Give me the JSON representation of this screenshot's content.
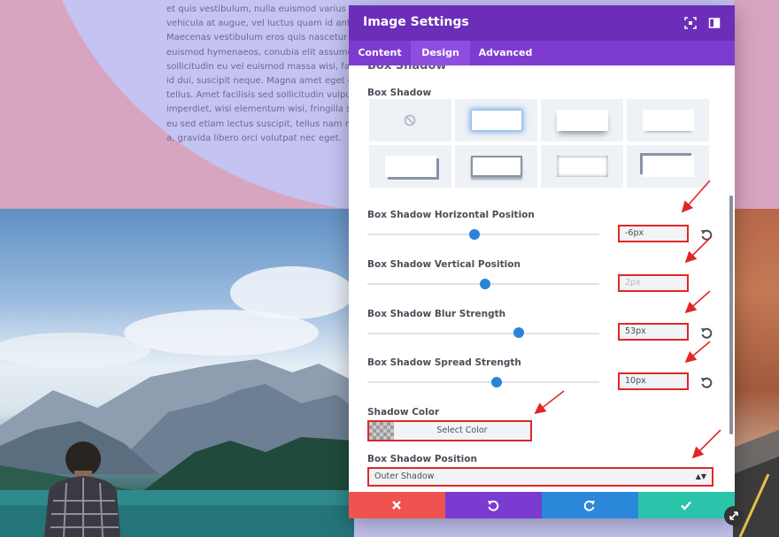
{
  "background": {
    "text_lines": [
      "et quis vestibulum, nulla euismod varius",
      "vehicula at augue, vel luctus quam id ante.",
      "Maecenas vestibulum eros quis nascetur",
      "euismod hymenaeos, conubia elit assumenda",
      "sollicitudin eu vel euismod massa wisi, facilis",
      "id dui, suscipit neque. Magna amet eget quam",
      "tellus. Amet facilisis sed sollicitudin vulputate",
      "imperdiet, wisi elementum wisi, fringilla solum",
      "eu sed etiam lectus suscipit, tellus nam non pede",
      "a, gravida libero orci volutpat nec eget."
    ]
  },
  "modal": {
    "title": "Image Settings",
    "tabs": [
      {
        "label": "Content"
      },
      {
        "label": "Design"
      },
      {
        "label": "Advanced"
      }
    ],
    "active_tab": "Design",
    "cut_heading": "Box Shadow",
    "box_shadow_label": "Box Shadow",
    "horizontal": {
      "label": "Box Shadow Horizontal Position",
      "value": "-6px"
    },
    "vertical": {
      "label": "Box Shadow Vertical Position",
      "value": "2px"
    },
    "blur": {
      "label": "Box Shadow Blur Strength",
      "value": "53px"
    },
    "spread": {
      "label": "Box Shadow Spread Strength",
      "value": "10px"
    },
    "shadow_color": {
      "label": "Shadow Color",
      "button_label": "Select Color"
    },
    "position": {
      "label": "Box Shadow Position",
      "selected": "Outer Shadow"
    }
  },
  "colors": {
    "header": "#6c2eb9",
    "tab_bar": "#7d3bd0",
    "slider": "#2a84d6",
    "highlight": "#e02727",
    "cancel": "#ef5350",
    "undo": "#7c3bd0",
    "redo": "#2b87da",
    "save": "#29c4a9"
  },
  "icons": [
    "no-shadow-icon",
    "expand-icon",
    "sidebar-toggle-icon",
    "reset-icon",
    "close-icon",
    "undo-icon",
    "redo-icon",
    "check-icon",
    "resize-icon"
  ]
}
